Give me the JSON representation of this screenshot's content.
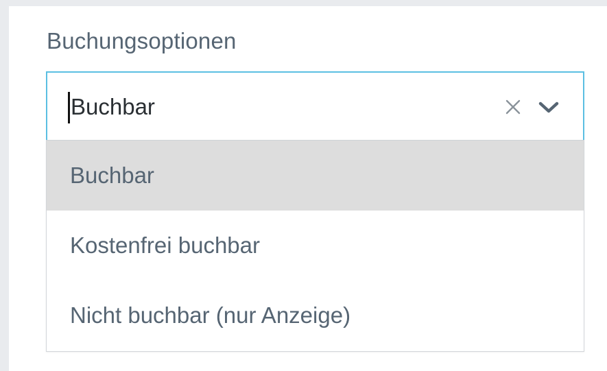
{
  "field": {
    "label": "Buchungsoptionen",
    "value": "Buchbar"
  },
  "icons": {
    "clear": "close-icon",
    "dropdown": "chevron-down-icon"
  },
  "menu": {
    "options": [
      {
        "label": "Buchbar",
        "focused": true
      },
      {
        "label": "Kostenfrei buchbar",
        "focused": false
      },
      {
        "label": "Nicht buchbar (nur Anzeige)",
        "focused": false
      }
    ]
  },
  "colors": {
    "focus_border": "#5bbfe2",
    "option_focused_bg": "#dddddd",
    "text": "#566573"
  }
}
